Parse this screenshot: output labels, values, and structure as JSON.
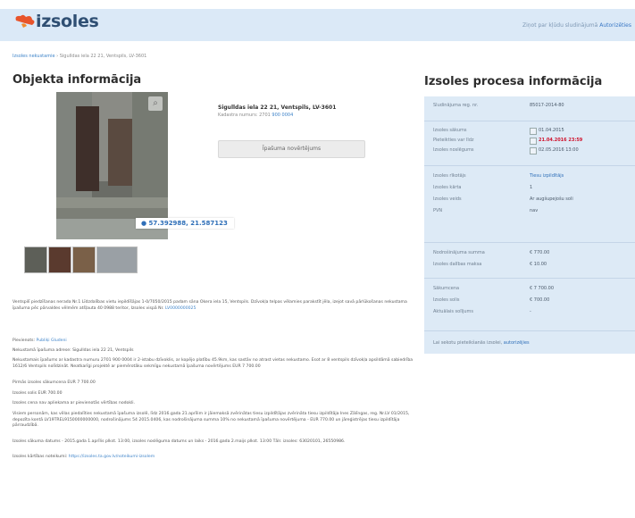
{
  "header": {
    "logo_text": "izsoles",
    "nav_text": "Ziņot par kļūdu sludinājumā",
    "nav_link": "Autorizēties"
  },
  "breadcrumb": {
    "root": "Izsoles nekustamie",
    "current": "Sigulldas iela 22 21, Ventspils, LV-3601"
  },
  "object_info": {
    "title": "Objekta informācija",
    "address_label": "Sigulldas iela 22 21, Ventspils, LV-3601",
    "cadastral_label": "Kadastra numurs: 2701",
    "cadastral_link": "900 0004",
    "doc_button": "Īpašuma novērtējums",
    "coords": "57.392988, 21.587123",
    "zoom_icon": "magnifier-icon",
    "pin_icon": "map-pin-icon"
  },
  "process_info": {
    "title": "Izsoles procesa informācija",
    "rows": [
      {
        "label": "Sludinājuma reg. nr.",
        "value": "85017-2014-80"
      },
      {
        "label": "Izsoles sākums",
        "value": "01.04.2015",
        "icon": "calendar-icon"
      },
      {
        "label": "Pieteikties var līdz",
        "value": "21.04.2016 23:59",
        "icon": "calendar-icon",
        "highlight": true
      },
      {
        "label": "Izsoles noslēgums",
        "value": "02.05.2016 13:00",
        "icon": "calendar-icon"
      },
      {
        "label": "Izsoles rīkotājs",
        "value": "Tiesu izpildītājs"
      },
      {
        "label": "Izsoles kārta",
        "value": "1"
      },
      {
        "label": "Izsoles veids",
        "value": "Ar augšupejošu soli"
      },
      {
        "label": "PVN",
        "value": "nav"
      },
      {
        "label": "Nodrošinājuma summa",
        "value": "€ 770.00"
      },
      {
        "label": "Izsoles dalības maksa",
        "value": "€ 10.00"
      },
      {
        "label": "Sākumcena",
        "value": "€ 7 700.00"
      },
      {
        "label": "Izsoles solis",
        "value": "€ 700.00"
      },
      {
        "label": "Aktuālais solījums",
        "value": "-"
      }
    ],
    "footer_text": "Lai sekotu pieteikšanās izsolei,",
    "footer_link": "autorizējies"
  },
  "description": {
    "p1": "Ventspilī piedzīšanas nerada Nr.1 Līdzdalības vietu iepildīšājas 1-0/7050/2015 padam sāna Okera iela 15, Ventspils. Dzīvokļa telpas vēlamies parakstīt jēla, izejot savā pārlūkošanas nekustama īpašuma pēc pārvaldes vēlmēm atšļauta 40 0988 teritor, Izsoles vispā Nr.",
    "p1_link": "LV0000000025",
    "p2_label": "Pievienots:",
    "p2_link": "Publiķi Gludeni",
    "p3": "Nekustamā īpašuma adrese: Sigulldas iela 22 21, Ventspils",
    "p4": "Nekustamais īpašums ar kadastra numuru 2701 900 0004 ir 2-istabu dzīvoklis, ar kopējo platību 45.9km, kas sastāv no atrast vietas nekustamo. Esot ar 8 ventspils dzīvokļa apsildāmā sabiedrība 1612/6 Ventspils nolīdzināt. Neatkarīgi projektē ar piemērotāku sekmīgu nekustamā īpašuma novērtējums EUR 7 700.00",
    "p5": "Pirmās izsoles sākumcena EUR 7 700.00",
    "p6": "Izsoles solis EUR 700.00",
    "p7": "Izsoles cena nav apliekama ar pievienotās vērtības nodokli.",
    "p8": "Visiem personām, kas vēlas piedalīties nekustamā īpašuma izsolē, līdz 2016.gada 21.aprīlim ir jāiemaksā zvērinātas tiesu izpildītājas zvērināta tiesu izpildītāja Ines Zālīngas, reg. Nr.LV 01/2015, depozīta kontā LV19TREL9150000000000, nodrošinājums 54 2015.0406, kas nodrošinājuma summa 10% no nekustamā īpašuma novērtējuma - EUR 770.00 un jāreģistrējas tiesu izpildītāja pārraudzībā.",
    "p9": "Izsoles sākuma datums - 2015.gada 1.aprīlis plkst. 13:00, izsoles noslēguma datums un laiks - 2016.gada 2.maijs plkst. 13:00 Tālr. izsoles: 63020101, 26550986.",
    "p10_label": "Izsoles kārtības noteikumi:",
    "p10_link": "https://izsoles.ta.gov.lv/noteikumi-izsolem"
  }
}
